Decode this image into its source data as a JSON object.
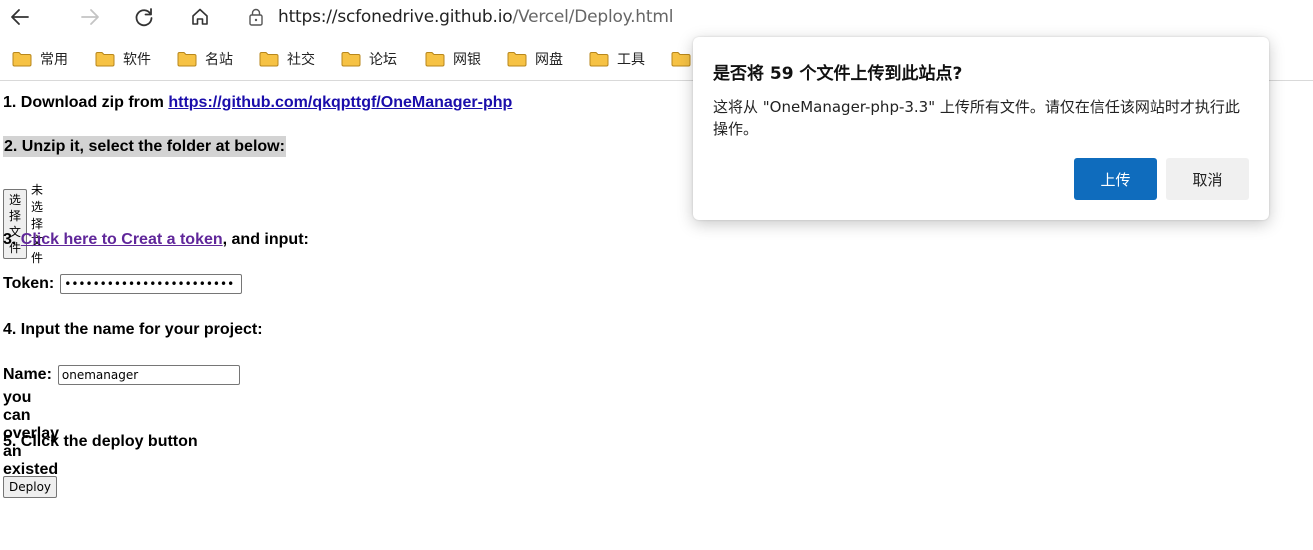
{
  "browser": {
    "url_host": "https://scfonedrive.github.io",
    "url_path": "/Vercel/Deploy.html",
    "bookmarks": [
      {
        "label": "常用"
      },
      {
        "label": "软件"
      },
      {
        "label": "名站"
      },
      {
        "label": "社交"
      },
      {
        "label": "论坛"
      },
      {
        "label": "网银"
      },
      {
        "label": "网盘"
      },
      {
        "label": "工具"
      }
    ]
  },
  "page": {
    "step1_text": "1. Download zip from ",
    "step1_link": "https://github.com/qkqpttgf/OneManager-php",
    "step2_text": "2. Unzip it, select the folder at below:",
    "file_button": "选择文件",
    "file_status": "未选择文件",
    "step3_prefix": "3. ",
    "step3_link": "Click here to Creat a token",
    "step3_suffix": ", and input:",
    "token_label": "Token:",
    "token_value": "••••••••••••••••••••••••",
    "step4_text": "4. Input the name for your project:",
    "name_label": "Name:",
    "name_value": "onemanager",
    "overlay_note": "you can overlay an existed project",
    "step5_text": "5. Click the deploy button",
    "deploy_button": "Deploy"
  },
  "dialog": {
    "title": "是否将 59 个文件上传到此站点?",
    "message": "这将从 \"OneManager-php-3.3\" 上传所有文件。请仅在信任该网站时才执行此操作。",
    "upload_button": "上传",
    "cancel_button": "取消"
  },
  "colors": {
    "accent": "#0f6cbd",
    "link": "#1a0dab",
    "visited_link": "#60279a",
    "folder": "#f6c244"
  }
}
